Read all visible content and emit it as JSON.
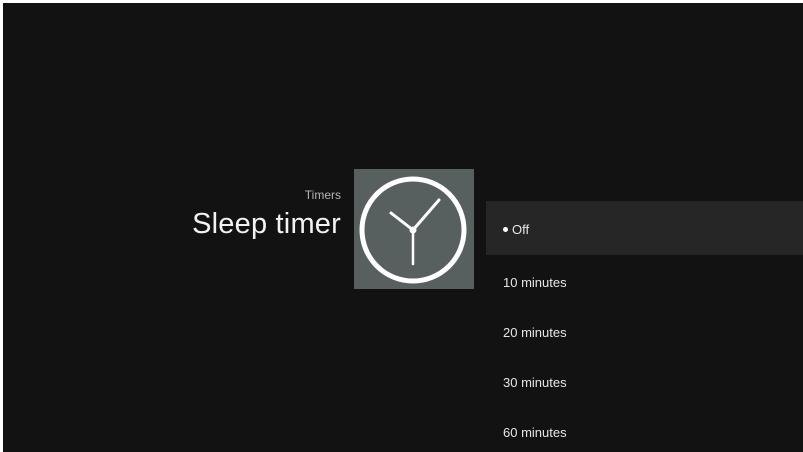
{
  "header": {
    "breadcrumb": "Timers",
    "title": "Sleep timer"
  },
  "icon": {
    "name": "clock-icon",
    "tile_color": "#58605f"
  },
  "options": [
    {
      "label": "Off",
      "selected": true
    },
    {
      "label": "10 minutes",
      "selected": false
    },
    {
      "label": "20 minutes",
      "selected": false
    },
    {
      "label": "30 minutes",
      "selected": false
    },
    {
      "label": "60 minutes",
      "selected": false
    }
  ],
  "colors": {
    "background": "#121212",
    "selected_row": "#262626"
  }
}
